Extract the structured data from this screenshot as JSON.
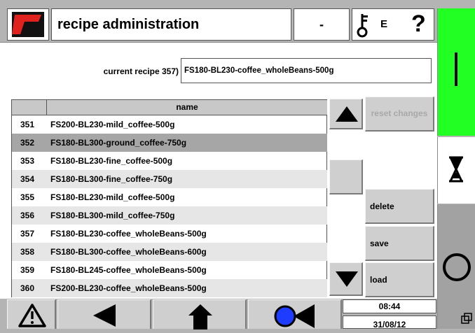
{
  "header": {
    "title": "recipe administration",
    "status": "-",
    "user_level": "E",
    "help": "?"
  },
  "current_recipe": {
    "label": "current recipe 357)",
    "value": "FS180-BL230-coffee_wholeBeans-500g"
  },
  "table": {
    "column_num": "",
    "column_name": "name",
    "selected_index": 1,
    "rows": [
      {
        "num": "351",
        "name": "FS200-BL230-mild_coffee-500g"
      },
      {
        "num": "352",
        "name": "FS180-BL300-ground_coffee-750g"
      },
      {
        "num": "353",
        "name": "FS180-BL230-fine_coffee-500g"
      },
      {
        "num": "354",
        "name": "FS180-BL300-fine_coffee-750g"
      },
      {
        "num": "355",
        "name": "FS180-BL230-mild_coffee-500g"
      },
      {
        "num": "356",
        "name": "FS180-BL300-mild_coffee-750g"
      },
      {
        "num": "357",
        "name": "FS180-BL230-coffee_wholeBeans-500g"
      },
      {
        "num": "358",
        "name": "FS180-BL300-coffee_wholeBeans-600g"
      },
      {
        "num": "359",
        "name": "FS180-BL245-coffee_wholeBeans-500g"
      },
      {
        "num": "360",
        "name": "FS200-BL230-coffee_wholeBeans-500g"
      }
    ]
  },
  "buttons": {
    "reset": "reset changes",
    "delete": "delete",
    "save": "save",
    "load": "load"
  },
  "footer": {
    "time": "08:44",
    "date": "31/08/12"
  },
  "colors": {
    "start_green": "#22ff22",
    "logo_red": "#e0221e",
    "record_blue": "#1e3cff"
  },
  "icons": {
    "logo": "logo-icon",
    "key": "key-icon",
    "warning": "warning-icon",
    "back": "arrow-left-icon",
    "home": "home-icon",
    "record": "record-icon",
    "hourglass": "hourglass-icon",
    "stop": "stop-circle-icon"
  }
}
